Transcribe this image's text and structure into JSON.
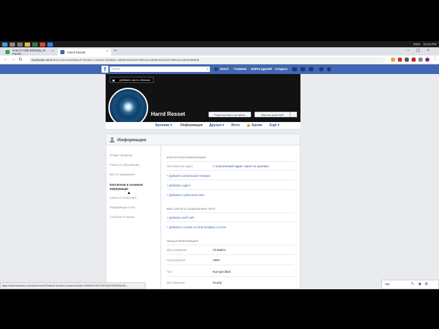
{
  "taskbar": {
    "time": "12:44 PM",
    "lang": "ENG"
  },
  "browser": {
    "tabs": [
      {
        "label": "How to Hide Birthday on Faceb…",
        "active": false
      },
      {
        "label": "Harrd Resset",
        "active": true
      }
    ],
    "new_tab": "+",
    "url_host": "facebook.com",
    "url_rest": "/harrd.reset.522/about?section=contact-info&lst=100054231401709%3A100054231401709%3A1600166005"
  },
  "fb_header": {
    "logo": "f",
    "search_placeholder": "Поиск",
    "user": "Harrd",
    "home": "Главная",
    "find_friends": "Найти друзей",
    "create": "Создать"
  },
  "profile": {
    "add_cover": "Добавить фото обложки",
    "name": "Harrd Resset",
    "edit_profile": "Редактировать профиль",
    "activity_log": "Журнал действий",
    "more_dots": "···",
    "tabs": [
      "Хроника ▾",
      "Информация",
      "Друзья ▾",
      "Фото",
      "🔒 Архив",
      "Ещё ▾"
    ]
  },
  "info": {
    "title": "Информация",
    "sidebar": [
      "Общие сведения",
      "Работа и образование",
      "Места проживания",
      "Контактная и основная информация",
      "Семья и отношения",
      "Информация о вас",
      "События из жизни"
    ],
    "contact": {
      "section_title": "КОНТАКТНАЯ ИНФОРМАЦИЯ",
      "email_label": "Электронный адрес",
      "email_value": "1 электронный адрес скрыт из хроники",
      "add_phone": "Добавить мобильный телефон",
      "add_address": "Добавить адрес",
      "add_public_key": "Добавить публичный ключ"
    },
    "websites": {
      "section_title": "ВЕБ-САЙТЫ И СОЦИАЛЬНЫЕ СЕТИ",
      "add_website": "Добавить веб-сайт",
      "add_social": "Добавить ссылки на свой профиль в сетях"
    },
    "basic": {
      "section_title": "ОБЩАЯ ИНФОРМАЦИЯ",
      "birth_date_label": "Дата рождения",
      "birth_date_value": "13 марта",
      "birth_year_label": "Год рождения",
      "birth_year_value": "1993",
      "gender_label": "Пол",
      "gender_value": "Not specified",
      "pronoun_label": "Местоимение",
      "pronoun_value": "Особа"
    }
  },
  "status_url": "https://www.facebook.com/harrd.reset.522/about?section=contact-info&lst=100054231401709%3A100054231401...",
  "chat": {
    "label": "Чат"
  }
}
